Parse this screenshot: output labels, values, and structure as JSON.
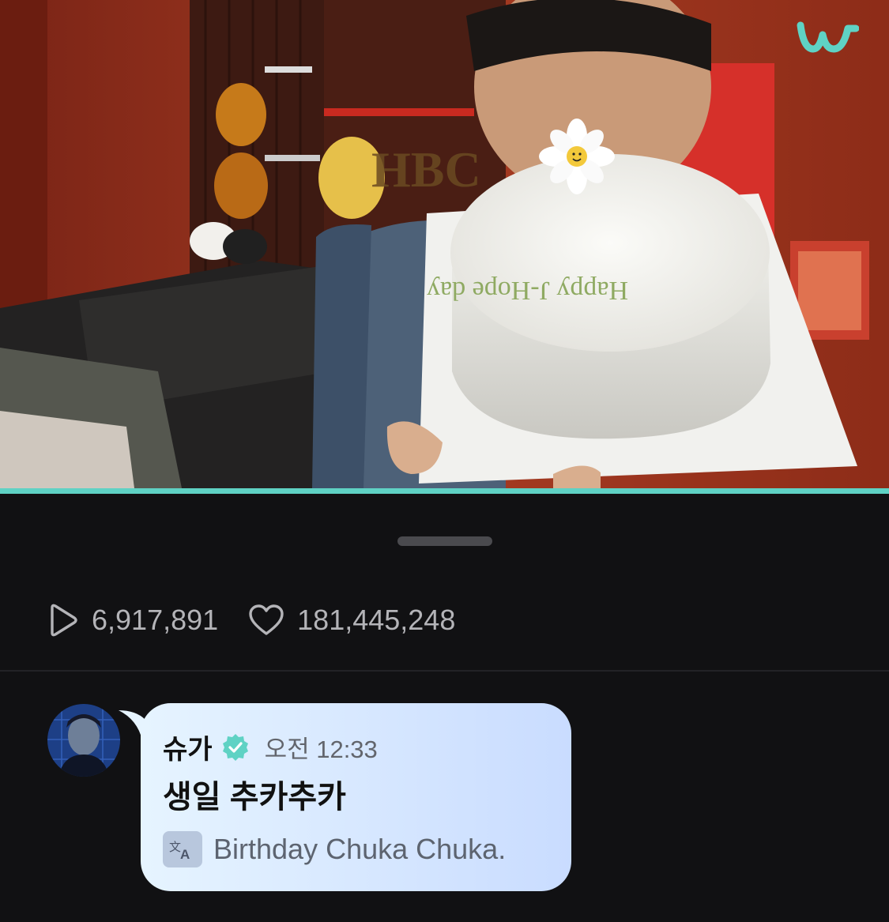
{
  "app": {
    "logo_icon": "weverse-w-logo",
    "accent_color": "#5fd2c4"
  },
  "video": {
    "progress": 1.0,
    "cake_text": "Happy J-Hope day"
  },
  "stats": {
    "play_icon": "play-icon",
    "plays": "6,917,891",
    "heart_icon": "heart-icon",
    "likes": "181,445,248"
  },
  "comment": {
    "author": "슈가",
    "verified_icon": "verified-badge-icon",
    "time": "오전 12:33",
    "message": "생일 추카추카",
    "translate_icon": "translate-icon",
    "translation": "Birthday Chuka Chuka."
  }
}
